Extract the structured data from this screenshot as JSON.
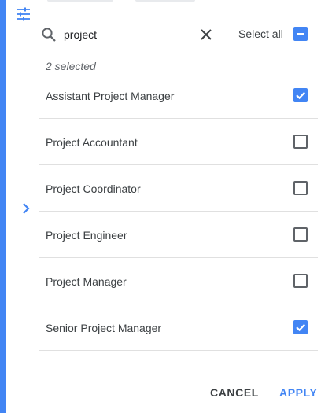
{
  "search": {
    "value": "project",
    "icon": "search-icon",
    "clear_icon": "close-icon"
  },
  "select_all": {
    "label": "Select all",
    "state": "indeterminate"
  },
  "selection_count": "2 selected",
  "options": [
    {
      "label": "Assistant Project Manager",
      "checked": true
    },
    {
      "label": "Project Accountant",
      "checked": false
    },
    {
      "label": "Project Coordinator",
      "checked": false
    },
    {
      "label": "Project Engineer",
      "checked": false
    },
    {
      "label": "Project Manager",
      "checked": false
    },
    {
      "label": "Senior Project Manager",
      "checked": true
    }
  ],
  "actions": {
    "cancel": "CANCEL",
    "apply": "APPLY"
  },
  "sidebar": {
    "filter_icon": "tune-icon",
    "expand_icon": "chevron-right-icon"
  },
  "colors": {
    "accent": "#4285f4",
    "focus_underline": "#1a73e8",
    "text": "#3c4043",
    "divider": "#e0e0e0"
  }
}
